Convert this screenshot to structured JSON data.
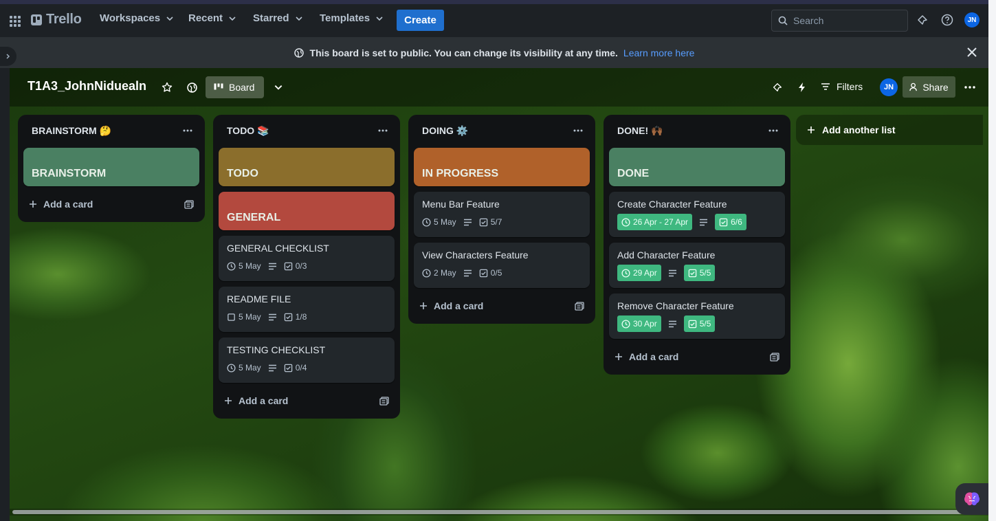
{
  "topnav": {
    "logo": "Trello",
    "menus": [
      {
        "label": "Workspaces"
      },
      {
        "label": "Recent"
      },
      {
        "label": "Starred"
      },
      {
        "label": "Templates"
      }
    ],
    "create_label": "Create",
    "search_placeholder": "Search",
    "avatar_initials": "JN"
  },
  "banner": {
    "message": "This board is set to public. You can change its visibility at any time.",
    "link": "Learn more here"
  },
  "board": {
    "title": "T1A3_JohnNiduealn",
    "view_label": "Board",
    "filters_label": "Filters",
    "member_initials": "JN",
    "share_label": "Share"
  },
  "lists": [
    {
      "title": "BRAINSTORM 🤔",
      "cover": {
        "label": "BRAINSTORM",
        "color": "#4a8062"
      },
      "add_label": "Add a card"
    },
    {
      "title": "TODO 📚",
      "covers": [
        {
          "label": "TODO",
          "color": "#8b6e2c"
        },
        {
          "label": "GENERAL",
          "color": "#b3493e"
        }
      ],
      "cards": [
        {
          "title": "GENERAL CHECKLIST",
          "date": "5 May",
          "checklist": "0/3"
        },
        {
          "title": "README FILE",
          "date": "5 May",
          "checklist": "1/8"
        },
        {
          "title": "TESTING CHECKLIST",
          "date": "5 May",
          "checklist": "0/4"
        }
      ],
      "add_label": "Add a card"
    },
    {
      "title": "DOING ⚙️",
      "cover": {
        "label": "IN PROGRESS",
        "color": "#b0612a"
      },
      "cards": [
        {
          "title": "Menu Bar Feature",
          "date": "5 May",
          "checklist": "5/7"
        },
        {
          "title": "View Characters Feature",
          "date": "2 May",
          "checklist": "0/5"
        }
      ],
      "add_label": "Add a card"
    },
    {
      "title": "DONE! 🙌🏾",
      "cover": {
        "label": "DONE",
        "color": "#4a8062"
      },
      "cards": [
        {
          "title": "Create Character Feature",
          "date": "26 Apr - 27 Apr",
          "checklist": "6/6"
        },
        {
          "title": "Add Character Feature",
          "date": "29 Apr",
          "checklist": "5/5"
        },
        {
          "title": "Remove Character Feature",
          "date": "30 Apr",
          "checklist": "5/5"
        }
      ],
      "add_label": "Add a card"
    }
  ],
  "add_list_label": "Add another list",
  "colors": {
    "accent": "#1f6fce",
    "complete_badge": "#3fb880",
    "list_bg": "#111315"
  }
}
